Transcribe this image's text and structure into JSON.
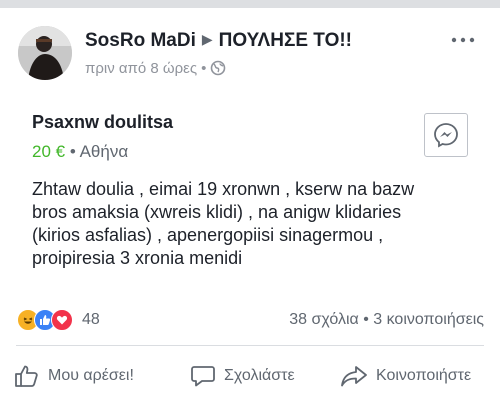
{
  "post": {
    "author": "SosRo MaDi",
    "target": "ΠΟΥΛΗΣΕ ΤΟ!!",
    "time": "πριν από 8 ώρες",
    "audience_icon": "globe-icon"
  },
  "listing": {
    "title": "Psaxnw doulitsa",
    "price": "20 €",
    "separator": "•",
    "location": "Αθήνα"
  },
  "description": [
    "Zhtaw doulia , eimai 19 xronwn , kserw na bazw",
    "bros amaksia (xwreis klidi)  , na anigw  klidaries",
    "(kirios asfalias) , apenergopiisi sinagermou ,",
    "proipiresia 3 xronia menidi"
  ],
  "engagement": {
    "reaction_count": "48",
    "comments": "38 σχόλια",
    "shares": "3 κοινοποιήσεις"
  },
  "actions": {
    "like": "Μου αρέσει!",
    "comment": "Σχολιάστε",
    "share": "Κοινοποιήστε"
  },
  "colors": {
    "price": "#42b72a",
    "like_reaction": "#3b82f6",
    "love_reaction": "#f2334b",
    "haha_reaction": "#f7b125"
  }
}
